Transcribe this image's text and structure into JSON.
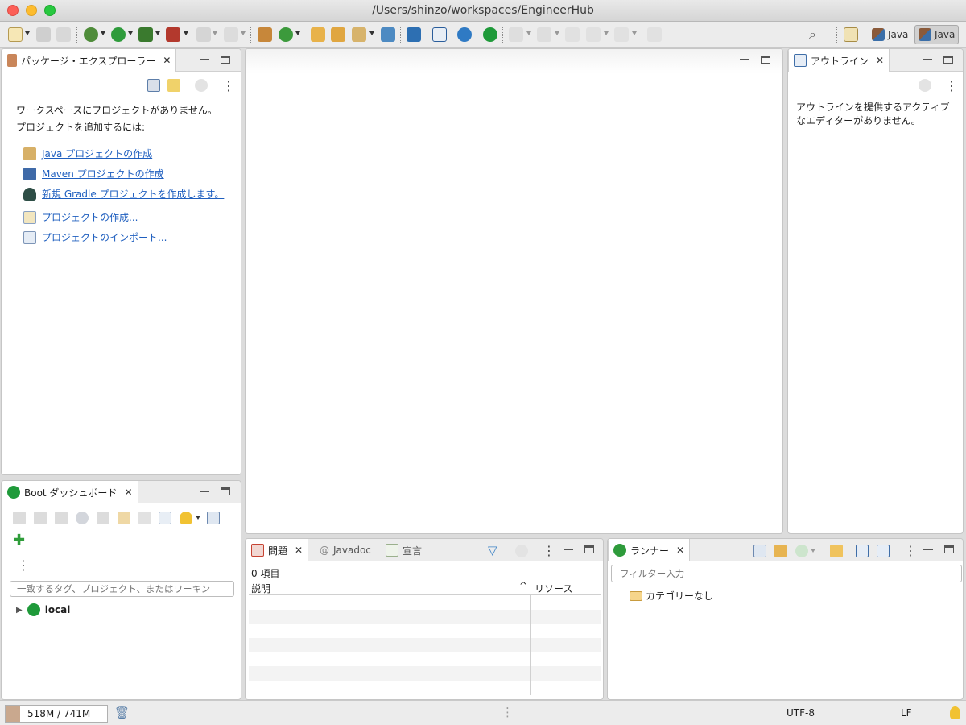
{
  "window": {
    "title": "/Users/shinzo/workspaces/EngineerHub"
  },
  "perspectives": {
    "java_label": "Java",
    "java_active_label": "Java"
  },
  "package_explorer": {
    "tab_label": "パッケージ・エクスプローラー",
    "message_line1": "ワークスペースにプロジェクトがありません。",
    "message_line2": "プロジェクトを追加するには:",
    "links": {
      "java_project": "Java プロジェクトの作成",
      "maven_project": "Maven プロジェクトの作成",
      "gradle_project": "新規 Gradle プロジェクトを作成します。",
      "create_project": "プロジェクトの作成...",
      "import_project": "プロジェクトのインポート..."
    }
  },
  "outline": {
    "tab_label": "アウトライン",
    "message": "アウトラインを提供するアクティブなエディターがありません。"
  },
  "boot_dashboard": {
    "tab_label": "Boot ダッシュボード",
    "filter_placeholder": "一致するタグ、プロジェクト、またはワーキン",
    "local_label": "local"
  },
  "problems": {
    "tabs": {
      "problems": "問題",
      "javadoc": "Javadoc",
      "declaration": "宣言"
    },
    "count_label": "0 項目",
    "columns": {
      "description": "説明",
      "resource": "リソース"
    }
  },
  "runner": {
    "tab_label": "ランナー",
    "filter_placeholder": "フィルター入力",
    "category_label": "カテゴリーなし"
  },
  "status_bar": {
    "heap_label": "518M / 741M",
    "heap_used_fraction": 0.7,
    "encoding": "UTF-8",
    "line_delimiter": "LF"
  }
}
